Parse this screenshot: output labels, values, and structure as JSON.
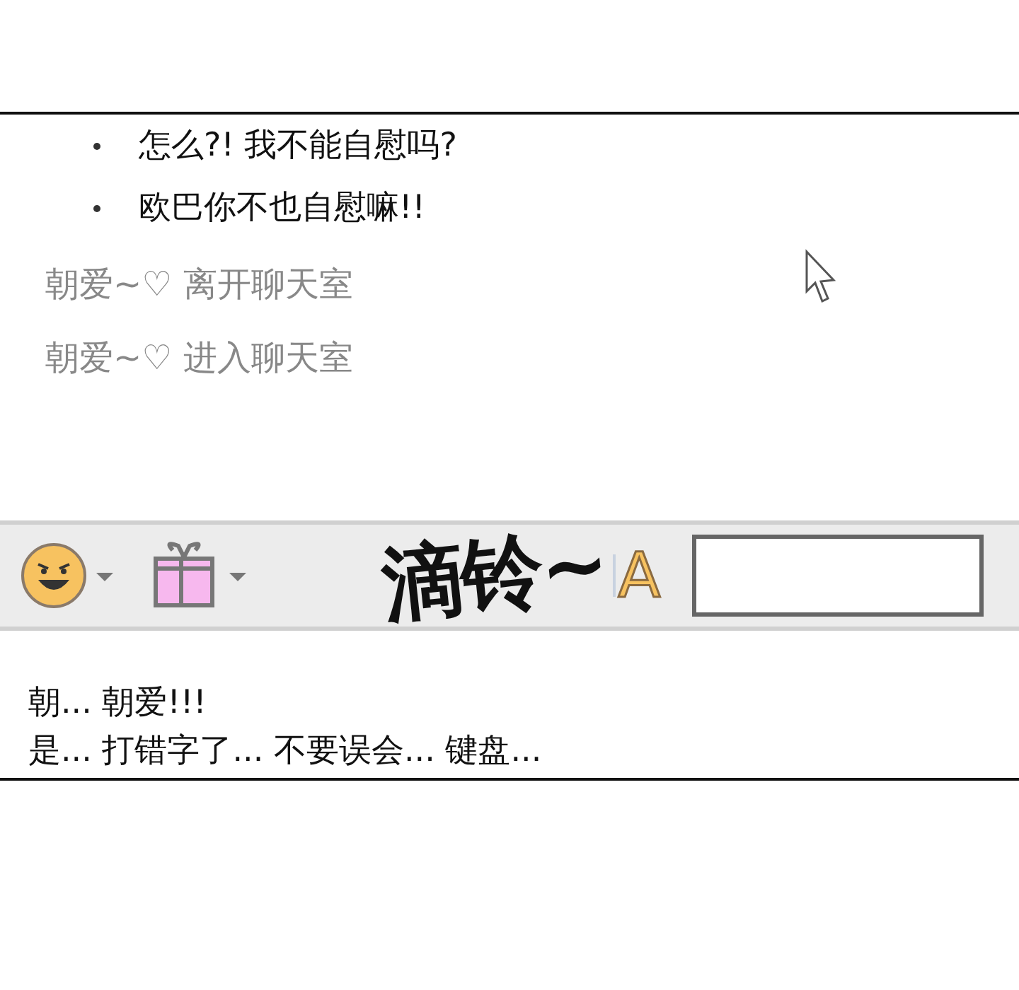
{
  "messages": [
    "怎么?! 我不能自慰吗?",
    "欧巴你不也自慰嘛!!"
  ],
  "system_messages": [
    "朝爱~♡ 离开聊天室",
    "朝爱~♡ 进入聊天室"
  ],
  "toolbar": {
    "sound_effect": "滴铃~",
    "font_button": "A"
  },
  "input": {
    "lines": [
      "朝... 朝爱!!!",
      "是... 打错字了... 不要误会... 键盘..."
    ]
  }
}
